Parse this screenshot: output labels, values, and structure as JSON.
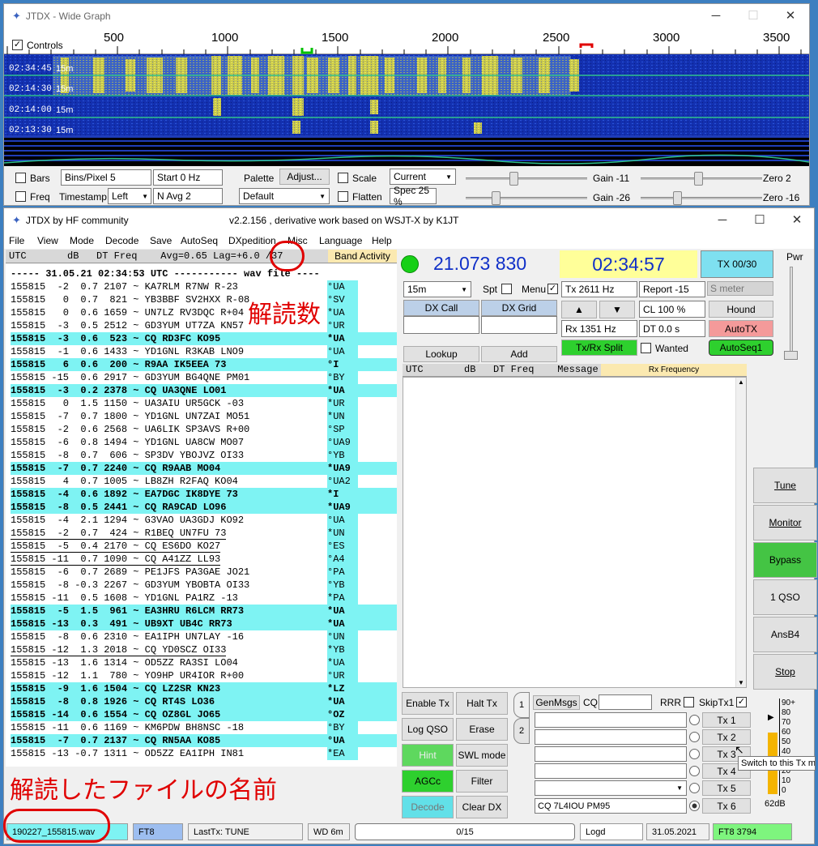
{
  "wide_graph": {
    "title": "JTDX - Wide Graph",
    "controls_label": "Controls",
    "freq_ticks": [
      "500",
      "1000",
      "1500",
      "2000",
      "2500",
      "3000",
      "3500"
    ],
    "rows": [
      {
        "time": "02:34:45",
        "band": "15m"
      },
      {
        "time": "02:14:30",
        "band": "15m"
      },
      {
        "time": "02:14:00",
        "band": "15m"
      },
      {
        "time": "02:13:30",
        "band": "15m"
      }
    ],
    "bars_label": "Bars",
    "freq_label": "Freq",
    "bins_per_pixel": "Bins/Pixel  5",
    "start": "Start 0 Hz",
    "timestamp_label": "Timestamp",
    "timestamp_value": "Left",
    "navg": "N Avg 2",
    "palette_label": "Palette",
    "adjust_label": "Adjust...",
    "palette_value": "Default",
    "scale_label": "Scale",
    "flatten_label": "Flatten",
    "current_value": "Current",
    "spec_value": "Spec 25 %",
    "gain1": "Gain -11",
    "zero1": "Zero 2",
    "gain2": "Gain -26",
    "zero2": "Zero -16"
  },
  "main": {
    "title_left": "JTDX  by HF community",
    "title_center": "v2.2.156 , derivative work based on WSJT-X by K1JT",
    "menu": [
      "File",
      "View",
      "Mode",
      "Decode",
      "Save",
      "AutoSeq",
      "DXpedition",
      "Misc",
      "Language",
      "Help"
    ],
    "band_header": "UTC       dB   DT Freq    Avg=0.65 Lag=+6.0 /37",
    "band_activity_label": "Band Activity",
    "separator": "----- 31.05.21 02:34:53 UTC ----------- wav file ----",
    "decodes": [
      {
        "t": "155815  -2  0.7 2107 ~ KA7RLM R7NW R-23",
        "c": "°UA",
        "hl": false,
        "u": false
      },
      {
        "t": "155815   0  0.7  821 ~ YB3BBF SV2HXX R-08",
        "c": "°SV",
        "hl": false,
        "u": false
      },
      {
        "t": "155815   0  0.6 1659 ~ UN7LZ RV3DQC R+04",
        "c": "*UA",
        "hl": false,
        "u": false
      },
      {
        "t": "155815  -3  0.5 2512 ~ GD3YUM UT7ZA KN57",
        "c": "°UR",
        "hl": false,
        "u": false
      },
      {
        "t": "155815  -3  0.6  523 ~ CQ RD3FC KO95",
        "c": "*UA",
        "hl": true,
        "u": false
      },
      {
        "t": "155815  -1  0.6 1433 ~ YD1GNL R3KAB LNO9",
        "c": "°UA",
        "hl": false,
        "u": false
      },
      {
        "t": "155815   6  0.6  200 ~ R9AA IK5EEA 73",
        "c": "°I",
        "hl": true,
        "u": false
      },
      {
        "t": "155815 -15  0.6 2917 ~ GD3YUM BG4QNE PM01",
        "c": "°BY",
        "hl": false,
        "u": false
      },
      {
        "t": "155815  -3  0.2 2378 ~ CQ UA3QNE LO01",
        "c": "*UA",
        "hl": true,
        "u": false
      },
      {
        "t": "155815   0  1.5 1150 ~ UA3AIU UR5GCK -03",
        "c": "*UR",
        "hl": false,
        "u": false
      },
      {
        "t": "155815  -7  0.7 1800 ~ YD1GNL UN7ZAI MO51",
        "c": "*UN",
        "hl": false,
        "u": false
      },
      {
        "t": "155815  -2  0.6 2568 ~ UA6LIK SP3AVS R+00",
        "c": "°SP",
        "hl": false,
        "u": false
      },
      {
        "t": "155815  -6  0.8 1494 ~ YD1GNL UA8CW MO07",
        "c": "°UA9",
        "hl": false,
        "u": false
      },
      {
        "t": "155815  -8  0.7  606 ~ SP3DV YBOJVZ OI33",
        "c": "°YB",
        "hl": false,
        "u": false
      },
      {
        "t": "155815  -7  0.7 2240 ~ CQ R9AAB MO04",
        "c": "*UA9",
        "hl": true,
        "u": false
      },
      {
        "t": "155815   4  0.7 1005 ~ LB8ZH R2FAQ KO04",
        "c": "°UA2",
        "hl": false,
        "u": false
      },
      {
        "t": "155815  -4  0.6 1892 ~ EA7DGC IK8DYE 73",
        "c": "*I",
        "hl": true,
        "u": false
      },
      {
        "t": "155815  -8  0.5 2441 ~ CQ RA9CAD LO96",
        "c": "*UA9",
        "hl": true,
        "u": false
      },
      {
        "t": "155815  -4  2.1 1294 ~ G3VAO UA3GDJ KO92",
        "c": "°UA",
        "hl": false,
        "u": false
      },
      {
        "t": "155815  -2  0.7  424 ~ R1BEQ UN7FU 73",
        "c": "*UN",
        "hl": false,
        "u": true
      },
      {
        "t": "155815  -5  0.4 2170 ~ CQ ES6DO KO27",
        "c": "°ES",
        "hl": false,
        "u": true
      },
      {
        "t": "155815 -11  0.7 1090 ~ CQ A41ZZ LL93",
        "c": "°A4",
        "hl": false,
        "u": true
      },
      {
        "t": "155815  -6  0.7 2689 ~ PE1JFS PA3GAE JO21",
        "c": "°PA",
        "hl": false,
        "u": false
      },
      {
        "t": "155815  -8 -0.3 2267 ~ GD3YUM YBOBTA OI33",
        "c": "°YB",
        "hl": false,
        "u": false
      },
      {
        "t": "155815 -11  0.5 1608 ~ YD1GNL PA1RZ -13",
        "c": "*PA",
        "hl": false,
        "u": false
      },
      {
        "t": "155815  -5  1.5  961 ~ EA3HRU R6LCM RR73",
        "c": "*UA",
        "hl": true,
        "u": false
      },
      {
        "t": "155815 -13  0.3  491 ~ UB9XT UB4C RR73",
        "c": "*UA",
        "hl": true,
        "u": false
      },
      {
        "t": "155815  -8  0.6 2310 ~ EA1IPH UN7LAY -16",
        "c": "°UN",
        "hl": false,
        "u": false
      },
      {
        "t": "155815 -12  1.3 2018 ~ CQ YD0SCZ OI33",
        "c": "*YB",
        "hl": false,
        "u": true
      },
      {
        "t": "155815 -13  1.6 1314 ~ OD5ZZ RA3SI LO04",
        "c": "*UA",
        "hl": false,
        "u": false
      },
      {
        "t": "155815 -12  1.1  780 ~ YO9HP UR4IOR R+00",
        "c": "°UR",
        "hl": false,
        "u": false
      },
      {
        "t": "155815  -9  1.6 1504 ~ CQ LZ2SR KN23",
        "c": "*LZ",
        "hl": true,
        "u": false
      },
      {
        "t": "155815  -8  0.8 1926 ~ CQ RT4S LO36",
        "c": "*UA",
        "hl": true,
        "u": false
      },
      {
        "t": "155815 -14  0.6 1554 ~ CQ OZ8GL JO65",
        "c": "°OZ",
        "hl": true,
        "u": false
      },
      {
        "t": "155815 -11  0.6 1169 ~ KM6PDW BH8NSC -18",
        "c": "°BY",
        "hl": false,
        "u": false
      },
      {
        "t": "155815  -7  0.7 2137 ~ CQ RN5AA KO85",
        "c": "°UA",
        "hl": true,
        "u": false
      },
      {
        "t": "155815 -13 -0.7 1311 ~ OD5ZZ EA1IPH IN81",
        "c": "*EA",
        "hl": false,
        "u": false
      }
    ],
    "freq_display": "21.073 830",
    "time_display": "02:34:57",
    "tx_counter": "TX 00/30",
    "pwr_label": "Pwr",
    "band_select": "15m",
    "spt_label": "Spt",
    "menu_label": "Menu",
    "tx_hz": "Tx  2611  Hz",
    "report": "Report -15",
    "s_meter": "S meter",
    "dx_call_label": "DX Call",
    "dx_grid_label": "DX Grid",
    "cl_value": "CL  100 %",
    "hound_label": "Hound",
    "rx_hz": "Rx   1351  Hz",
    "dt_value": "DT 0.0 s",
    "autotx_label": "AutoTX",
    "lookup_label": "Lookup",
    "add_label": "Add",
    "txrx_split_label": "Tx/Rx Split",
    "wanted_label": "Wanted",
    "autoseq_label": "AutoSeq1",
    "rx_header": "UTC       dB   DT Freq    Message",
    "rx_frequency_label": "Rx Frequency",
    "right_buttons": [
      "Tune",
      "Monitor",
      "Bypass",
      "1 QSO",
      "AnsB4",
      "Stop"
    ],
    "left_buttons": [
      "Enable Tx",
      "Halt Tx",
      "Log QSO",
      "Erase",
      "Hint",
      "SWL mode",
      "AGCc",
      "Filter",
      "Decode",
      "Clear DX"
    ],
    "tab1": "1",
    "tab2": "2",
    "genmsgs_label": "GenMsgs",
    "cq_label": "CQ",
    "rrr_label": "RRR",
    "skiptx1_label": "SkipTx1",
    "tx_buttons": [
      "Tx 1",
      "Tx 2",
      "Tx 3",
      "Tx 4",
      "Tx 5",
      "Tx 6"
    ],
    "tx6_message": "CQ 7L4IOU PM95",
    "tooltip": "Switch to this Tx m",
    "meter_ticks": [
      "90+",
      "80",
      "70",
      "60",
      "50",
      "40",
      "30",
      "20",
      "10",
      "0"
    ],
    "meter_db": "62dB",
    "status": {
      "wav": "190227_155815.wav",
      "mode": "FT8",
      "lasttx": "LastTx: TUNE",
      "wd": "WD 6m",
      "progress": "0/15",
      "logd": "Logd",
      "date": "31.05.2021",
      "mode_freq": "FT8  3794"
    }
  },
  "annotations": {
    "decode_count": "解読数",
    "file_name": "解読したファイルの名前"
  },
  "colors": {
    "waterfall": "#1330b0",
    "highlight": "#7ef3f3",
    "green": "#5ed85e",
    "red_button": "#f49a9a",
    "yellow": "#ffff99"
  }
}
